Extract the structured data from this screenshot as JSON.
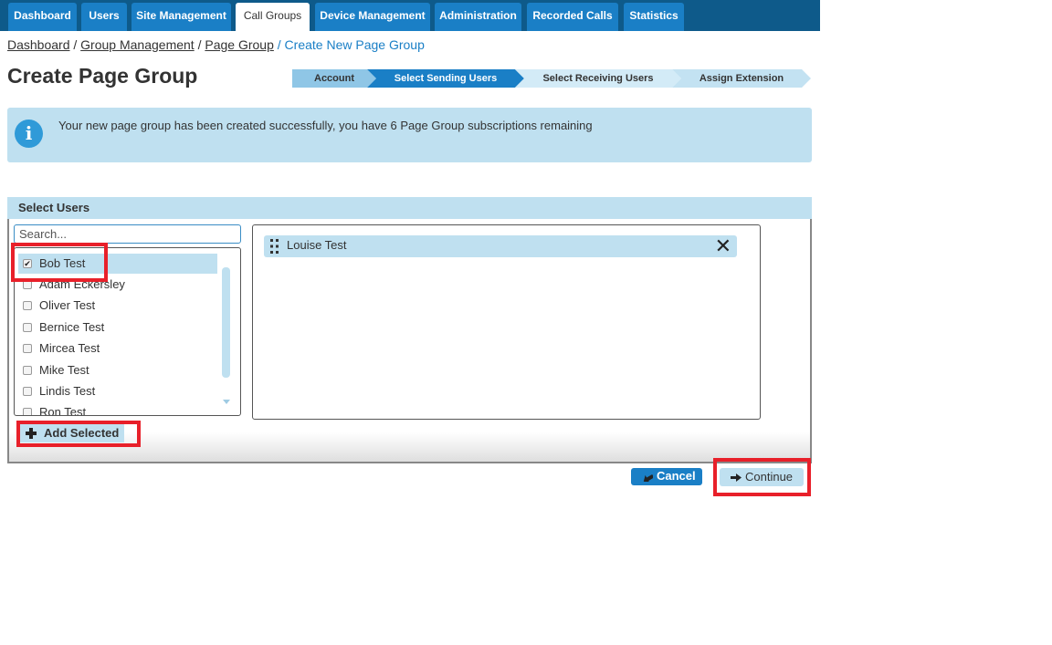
{
  "nav": {
    "tabs": [
      {
        "label": "Dashboard",
        "active": false
      },
      {
        "label": "Users",
        "active": false
      },
      {
        "label": "Site Management",
        "active": false
      },
      {
        "label": "Call Groups",
        "active": true
      },
      {
        "label": "Device Management",
        "active": false
      },
      {
        "label": "Administration",
        "active": false
      },
      {
        "label": "Recorded Calls",
        "active": false
      },
      {
        "label": "Statistics",
        "active": false
      }
    ]
  },
  "breadcrumb": {
    "items": [
      "Dashboard",
      "Group Management",
      "Page Group"
    ],
    "separator": " / ",
    "current": "Create New Page Group"
  },
  "page": {
    "title": "Create Page Group"
  },
  "wizard": {
    "steps": [
      {
        "label": "Account",
        "state": "done"
      },
      {
        "label": "Select Sending Users",
        "state": "active"
      },
      {
        "label": "Select Receiving Users",
        "state": "pending"
      },
      {
        "label": "Assign Extension",
        "state": "pending"
      }
    ]
  },
  "info": {
    "icon": "info-icon",
    "icon_glyph": "i",
    "message": "Your new page group has been created successfully, you have 6 Page Group subscriptions remaining"
  },
  "select_users": {
    "header": "Select Users",
    "search_placeholder": "Search...",
    "users": [
      {
        "name": "Bob Test",
        "checked": true
      },
      {
        "name": "Adam Eckersley",
        "checked": false
      },
      {
        "name": "Oliver Test",
        "checked": false
      },
      {
        "name": "Bernice Test",
        "checked": false
      },
      {
        "name": "Mircea Test",
        "checked": false
      },
      {
        "name": "Mike Test",
        "checked": false
      },
      {
        "name": "Lindis Test",
        "checked": false
      },
      {
        "name": "Ron Test",
        "checked": false
      }
    ],
    "add_label": "Add Selected",
    "selected": [
      {
        "name": "Louise Test"
      }
    ]
  },
  "actions": {
    "cancel_label": "Cancel",
    "continue_label": "Continue"
  },
  "colors": {
    "nav_bar": "#0e5a8a",
    "tab": "#1a7fc6",
    "panel": "#bfe0f0",
    "highlight": "#e8202a"
  }
}
